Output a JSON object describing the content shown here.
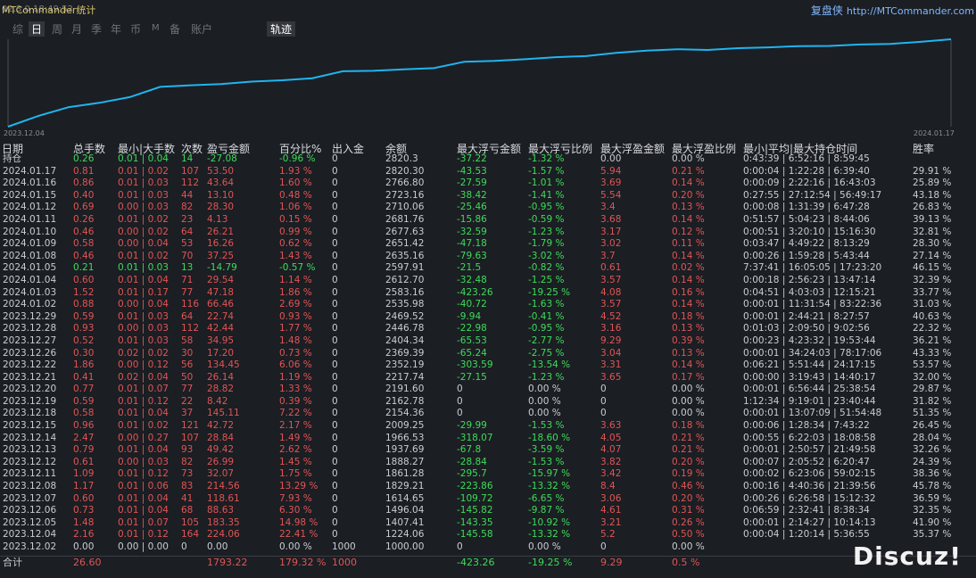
{
  "header": {
    "title": "MTCommander统计",
    "title_ghost": "02.3.0    18:49:52",
    "brand_name": "复盘侠",
    "brand_url": "http://MTCommander.com"
  },
  "tabs": [
    {
      "label": "综",
      "active": false
    },
    {
      "label": "日",
      "active": true
    },
    {
      "label": "周",
      "active": false
    },
    {
      "label": "月",
      "active": false
    },
    {
      "label": "季",
      "active": false
    },
    {
      "label": "年",
      "active": false
    },
    {
      "label": "币",
      "active": false
    },
    {
      "label": "M",
      "active": false
    },
    {
      "label": "备",
      "active": false
    },
    {
      "label": "账户",
      "active": false
    }
  ],
  "track_tab": "轨迹",
  "chart_data": {
    "type": "line",
    "x_start": "2023.12.04",
    "x_end": "2024.01.17",
    "x": [
      "2023.12.02",
      "2023.12.04",
      "2023.12.05",
      "2023.12.06",
      "2023.12.07",
      "2023.12.08",
      "2023.12.11",
      "2023.12.12",
      "2023.12.13",
      "2023.12.14",
      "2023.12.15",
      "2023.12.18",
      "2023.12.19",
      "2023.12.20",
      "2023.12.21",
      "2023.12.22",
      "2023.12.26",
      "2023.12.27",
      "2023.12.28",
      "2023.12.29",
      "2024.01.02",
      "2024.01.03",
      "2024.01.04",
      "2024.01.05",
      "2024.01.08",
      "2024.01.09",
      "2024.01.10",
      "2024.01.11",
      "2024.01.12",
      "2024.01.15",
      "2024.01.16",
      "2024.01.17"
    ],
    "values": [
      1000.0,
      1224.06,
      1407.41,
      1496.04,
      1614.65,
      1829.21,
      1861.28,
      1888.27,
      1937.69,
      1966.53,
      2009.25,
      2154.36,
      2162.78,
      2191.6,
      2217.74,
      2352.19,
      2369.39,
      2404.34,
      2446.78,
      2469.52,
      2535.98,
      2583.16,
      2612.7,
      2597.91,
      2635.16,
      2651.42,
      2677.63,
      2681.76,
      2710.06,
      2723.16,
      2766.8,
      2820.3
    ],
    "color": "#1fb5f0"
  },
  "table": {
    "columns": [
      "日期",
      "总手数",
      "最小|大手数",
      "次数",
      "盈亏金额",
      "百分比%",
      "出入金",
      "余额",
      "最大浮亏金额",
      "最大浮亏比例",
      "最大浮盈金额",
      "最大浮盈比例",
      "最小|平均|最大持仓时间",
      "胜率"
    ],
    "open_row": {
      "date": "持仓",
      "lots": "0.26",
      "minmax": "0.01 | 0.04",
      "count": "14",
      "pl": "-27.08",
      "pct": "-0.96 %",
      "io": "0",
      "balance": "2820.3",
      "maxloss": "-37.22",
      "maxloss_pct": "-1.32 %",
      "maxgain": "0.00",
      "maxgain_pct": "0.00 %",
      "hold": "0:43:39 | 6:52:16 | 8:59:45",
      "win": ""
    },
    "rows": [
      {
        "date": "2024.01.17",
        "lots": "0.81",
        "minmax": "0.01 | 0.02",
        "count": "107",
        "pl": "53.50",
        "pct": "1.93 %",
        "io": "0",
        "balance": "2820.30",
        "maxloss": "-43.53",
        "maxloss_pct": "-1.57 %",
        "maxgain": "5.94",
        "maxgain_pct": "0.21 %",
        "hold": "0:00:04 | 1:22:28 | 6:39:40",
        "win": "29.91 %"
      },
      {
        "date": "2024.01.16",
        "lots": "0.86",
        "minmax": "0.01 | 0.03",
        "count": "112",
        "pl": "43.64",
        "pct": "1.60 %",
        "io": "0",
        "balance": "2766.80",
        "maxloss": "-27.59",
        "maxloss_pct": "-1.01 %",
        "maxgain": "3.69",
        "maxgain_pct": "0.14 %",
        "hold": "0:00:09 | 2:22:16 | 16:43:03",
        "win": "25.89 %"
      },
      {
        "date": "2024.01.15",
        "lots": "0.40",
        "minmax": "0.01 | 0.03",
        "count": "44",
        "pl": "13.10",
        "pct": "0.48 %",
        "io": "0",
        "balance": "2723.16",
        "maxloss": "-38.42",
        "maxloss_pct": "-1.41 %",
        "maxgain": "5.54",
        "maxgain_pct": "0.20 %",
        "hold": "0:27:55 | 27:12:54 | 56:49:17",
        "win": "43.18 %"
      },
      {
        "date": "2024.01.12",
        "lots": "0.69",
        "minmax": "0.00 | 0.03",
        "count": "82",
        "pl": "28.30",
        "pct": "1.06 %",
        "io": "0",
        "balance": "2710.06",
        "maxloss": "-25.46",
        "maxloss_pct": "-0.95 %",
        "maxgain": "3.4",
        "maxgain_pct": "0.13 %",
        "hold": "0:00:08 | 1:31:39 | 6:47:28",
        "win": "26.83 %"
      },
      {
        "date": "2024.01.11",
        "lots": "0.26",
        "minmax": "0.01 | 0.02",
        "count": "23",
        "pl": "4.13",
        "pct": "0.15 %",
        "io": "0",
        "balance": "2681.76",
        "maxloss": "-15.86",
        "maxloss_pct": "-0.59 %",
        "maxgain": "3.68",
        "maxgain_pct": "0.14 %",
        "hold": "0:51:57 | 5:04:23 | 8:44:06",
        "win": "39.13 %"
      },
      {
        "date": "2024.01.10",
        "lots": "0.46",
        "minmax": "0.00 | 0.02",
        "count": "64",
        "pl": "26.21",
        "pct": "0.99 %",
        "io": "0",
        "balance": "2677.63",
        "maxloss": "-32.59",
        "maxloss_pct": "-1.23 %",
        "maxgain": "3.17",
        "maxgain_pct": "0.12 %",
        "hold": "0:00:51 | 3:20:10 | 15:16:30",
        "win": "32.81 %"
      },
      {
        "date": "2024.01.09",
        "lots": "0.58",
        "minmax": "0.00 | 0.04",
        "count": "53",
        "pl": "16.26",
        "pct": "0.62 %",
        "io": "0",
        "balance": "2651.42",
        "maxloss": "-47.18",
        "maxloss_pct": "-1.79 %",
        "maxgain": "3.02",
        "maxgain_pct": "0.11 %",
        "hold": "0:03:47 | 4:49:22 | 8:13:29",
        "win": "28.30 %"
      },
      {
        "date": "2024.01.08",
        "lots": "0.46",
        "minmax": "0.01 | 0.02",
        "count": "70",
        "pl": "37.25",
        "pct": "1.43 %",
        "io": "0",
        "balance": "2635.16",
        "maxloss": "-79.63",
        "maxloss_pct": "-3.02 %",
        "maxgain": "3.7",
        "maxgain_pct": "0.14 %",
        "hold": "0:00:26 | 1:59:28 | 5:43:44",
        "win": "27.14 %"
      },
      {
        "date": "2024.01.05",
        "lots": "0.21",
        "minmax": "0.01 | 0.03",
        "count": "13",
        "pl": "-14.79",
        "pct": "-0.57 %",
        "io": "0",
        "balance": "2597.91",
        "maxloss": "-21.5",
        "maxloss_pct": "-0.82 %",
        "maxgain": "0.61",
        "maxgain_pct": "0.02 %",
        "hold": "7:37:41 | 16:05:05 | 17:23:20",
        "win": "46.15 %",
        "positive": true
      },
      {
        "date": "2024.01.04",
        "lots": "0.60",
        "minmax": "0.01 | 0.04",
        "count": "71",
        "pl": "29.54",
        "pct": "1.14 %",
        "io": "0",
        "balance": "2612.70",
        "maxloss": "-32.48",
        "maxloss_pct": "-1.25 %",
        "maxgain": "3.57",
        "maxgain_pct": "0.14 %",
        "hold": "0:00:18 | 2:56:23 | 13:47:14",
        "win": "32.39 %"
      },
      {
        "date": "2024.01.03",
        "lots": "1.52",
        "minmax": "0.01 | 0.17",
        "count": "77",
        "pl": "47.18",
        "pct": "1.86 %",
        "io": "0",
        "balance": "2583.16",
        "maxloss": "-423.26",
        "maxloss_pct": "-19.25 %",
        "maxgain": "4.08",
        "maxgain_pct": "0.16 %",
        "hold": "0:04:51 | 4:03:03 | 12:15:21",
        "win": "33.77 %"
      },
      {
        "date": "2024.01.02",
        "lots": "0.88",
        "minmax": "0.00 | 0.04",
        "count": "116",
        "pl": "66.46",
        "pct": "2.69 %",
        "io": "0",
        "balance": "2535.98",
        "maxloss": "-40.72",
        "maxloss_pct": "-1.63 %",
        "maxgain": "3.57",
        "maxgain_pct": "0.14 %",
        "hold": "0:00:01 | 11:31:54 | 83:22:36",
        "win": "31.03 %"
      },
      {
        "date": "2023.12.29",
        "lots": "0.59",
        "minmax": "0.01 | 0.03",
        "count": "64",
        "pl": "22.74",
        "pct": "0.93 %",
        "io": "0",
        "balance": "2469.52",
        "maxloss": "-9.94",
        "maxloss_pct": "-0.41 %",
        "maxgain": "4.52",
        "maxgain_pct": "0.18 %",
        "hold": "0:00:01 | 2:44:21 | 8:27:57",
        "win": "40.63 %"
      },
      {
        "date": "2023.12.28",
        "lots": "0.93",
        "minmax": "0.00 | 0.03",
        "count": "112",
        "pl": "42.44",
        "pct": "1.77 %",
        "io": "0",
        "balance": "2446.78",
        "maxloss": "-22.98",
        "maxloss_pct": "-0.95 %",
        "maxgain": "3.16",
        "maxgain_pct": "0.13 %",
        "hold": "0:01:03 | 2:09:50 | 9:02:56",
        "win": "22.32 %"
      },
      {
        "date": "2023.12.27",
        "lots": "0.52",
        "minmax": "0.01 | 0.03",
        "count": "58",
        "pl": "34.95",
        "pct": "1.48 %",
        "io": "0",
        "balance": "2404.34",
        "maxloss": "-65.53",
        "maxloss_pct": "-2.77 %",
        "maxgain": "9.29",
        "maxgain_pct": "0.39 %",
        "hold": "0:00:23 | 4:23:32 | 19:53:44",
        "win": "36.21 %"
      },
      {
        "date": "2023.12.26",
        "lots": "0.30",
        "minmax": "0.02 | 0.02",
        "count": "30",
        "pl": "17.20",
        "pct": "0.73 %",
        "io": "0",
        "balance": "2369.39",
        "maxloss": "-65.24",
        "maxloss_pct": "-2.75 %",
        "maxgain": "3.04",
        "maxgain_pct": "0.13 %",
        "hold": "0:00:01 | 34:24:03 | 78:17:06",
        "win": "43.33 %"
      },
      {
        "date": "2023.12.22",
        "lots": "1.86",
        "minmax": "0.00 | 0.12",
        "count": "56",
        "pl": "134.45",
        "pct": "6.06 %",
        "io": "0",
        "balance": "2352.19",
        "maxloss": "-303.59",
        "maxloss_pct": "-13.54 %",
        "maxgain": "3.31",
        "maxgain_pct": "0.14 %",
        "hold": "0:06:21 | 5:51:44 | 24:17:15",
        "win": "53.57 %"
      },
      {
        "date": "2023.12.21",
        "lots": "0.41",
        "minmax": "0.02 | 0.04",
        "count": "50",
        "pl": "26.14",
        "pct": "1.19 %",
        "io": "0",
        "balance": "2217.74",
        "maxloss": "-27.15",
        "maxloss_pct": "-1.23 %",
        "maxgain": "3.65",
        "maxgain_pct": "0.17 %",
        "hold": "0:00:00 | 3:19:43 | 14:40:17",
        "win": "32.00 %"
      },
      {
        "date": "2023.12.20",
        "lots": "0.77",
        "minmax": "0.01 | 0.07",
        "count": "77",
        "pl": "28.82",
        "pct": "1.33 %",
        "io": "0",
        "balance": "2191.60",
        "maxloss": "0",
        "maxloss_pct": "0.00 %",
        "maxgain": "0",
        "maxgain_pct": "0.00 %",
        "hold": "0:00:01 | 6:56:44 | 25:38:54",
        "win": "29.87 %"
      },
      {
        "date": "2023.12.19",
        "lots": "0.59",
        "minmax": "0.01 | 0.12",
        "count": "22",
        "pl": "8.42",
        "pct": "0.39 %",
        "io": "0",
        "balance": "2162.78",
        "maxloss": "0",
        "maxloss_pct": "0.00 %",
        "maxgain": "0",
        "maxgain_pct": "0.00 %",
        "hold": "1:12:34 | 9:19:01 | 23:40:44",
        "win": "31.82 %"
      },
      {
        "date": "2023.12.18",
        "lots": "0.58",
        "minmax": "0.01 | 0.04",
        "count": "37",
        "pl": "145.11",
        "pct": "7.22 %",
        "io": "0",
        "balance": "2154.36",
        "maxloss": "0",
        "maxloss_pct": "0.00 %",
        "maxgain": "0",
        "maxgain_pct": "0.00 %",
        "hold": "0:00:01 | 13:07:09 | 51:54:48",
        "win": "51.35 %"
      },
      {
        "date": "2023.12.15",
        "lots": "0.96",
        "minmax": "0.01 | 0.02",
        "count": "121",
        "pl": "42.72",
        "pct": "2.17 %",
        "io": "0",
        "balance": "2009.25",
        "maxloss": "-29.99",
        "maxloss_pct": "-1.53 %",
        "maxgain": "3.63",
        "maxgain_pct": "0.18 %",
        "hold": "0:00:06 | 1:28:34 | 7:43:22",
        "win": "26.45 %"
      },
      {
        "date": "2023.12.14",
        "lots": "2.47",
        "minmax": "0.00 | 0.27",
        "count": "107",
        "pl": "28.84",
        "pct": "1.49 %",
        "io": "0",
        "balance": "1966.53",
        "maxloss": "-318.07",
        "maxloss_pct": "-18.60 %",
        "maxgain": "4.05",
        "maxgain_pct": "0.21 %",
        "hold": "0:00:55 | 6:22:03 | 18:08:58",
        "win": "28.04 %"
      },
      {
        "date": "2023.12.13",
        "lots": "0.79",
        "minmax": "0.01 | 0.04",
        "count": "93",
        "pl": "49.42",
        "pct": "2.62 %",
        "io": "0",
        "balance": "1937.69",
        "maxloss": "-67.8",
        "maxloss_pct": "-3.59 %",
        "maxgain": "4.07",
        "maxgain_pct": "0.21 %",
        "hold": "0:00:01 | 2:50:57 | 21:49:58",
        "win": "32.26 %"
      },
      {
        "date": "2023.12.12",
        "lots": "0.61",
        "minmax": "0.00 | 0.03",
        "count": "82",
        "pl": "26.99",
        "pct": "1.45 %",
        "io": "0",
        "balance": "1888.27",
        "maxloss": "-28.84",
        "maxloss_pct": "-1.53 %",
        "maxgain": "3.82",
        "maxgain_pct": "0.20 %",
        "hold": "0:00:07 | 2:05:52 | 6:20:47",
        "win": "24.39 %"
      },
      {
        "date": "2023.12.11",
        "lots": "1.09",
        "minmax": "0.01 | 0.12",
        "count": "73",
        "pl": "32.07",
        "pct": "1.75 %",
        "io": "0",
        "balance": "1861.28",
        "maxloss": "-295.7",
        "maxloss_pct": "-15.97 %",
        "maxgain": "3.42",
        "maxgain_pct": "0.19 %",
        "hold": "0:00:02 | 6:23:06 | 59:02:15",
        "win": "38.36 %"
      },
      {
        "date": "2023.12.08",
        "lots": "1.17",
        "minmax": "0.01 | 0.06",
        "count": "83",
        "pl": "214.56",
        "pct": "13.29 %",
        "io": "0",
        "balance": "1829.21",
        "maxloss": "-223.86",
        "maxloss_pct": "-13.32 %",
        "maxgain": "8.4",
        "maxgain_pct": "0.46 %",
        "hold": "0:00:16 | 4:40:36 | 21:39:56",
        "win": "45.78 %"
      },
      {
        "date": "2023.12.07",
        "lots": "0.60",
        "minmax": "0.01 | 0.04",
        "count": "41",
        "pl": "118.61",
        "pct": "7.93 %",
        "io": "0",
        "balance": "1614.65",
        "maxloss": "-109.72",
        "maxloss_pct": "-6.65 %",
        "maxgain": "3.06",
        "maxgain_pct": "0.20 %",
        "hold": "0:00:26 | 6:26:58 | 15:12:32",
        "win": "36.59 %"
      },
      {
        "date": "2023.12.06",
        "lots": "0.73",
        "minmax": "0.01 | 0.04",
        "count": "68",
        "pl": "88.63",
        "pct": "6.30 %",
        "io": "0",
        "balance": "1496.04",
        "maxloss": "-145.82",
        "maxloss_pct": "-9.87 %",
        "maxgain": "4.61",
        "maxgain_pct": "0.31 %",
        "hold": "0:06:59 | 2:32:41 | 8:38:34",
        "win": "32.35 %"
      },
      {
        "date": "2023.12.05",
        "lots": "1.48",
        "minmax": "0.01 | 0.07",
        "count": "105",
        "pl": "183.35",
        "pct": "14.98 %",
        "io": "0",
        "balance": "1407.41",
        "maxloss": "-143.35",
        "maxloss_pct": "-10.92 %",
        "maxgain": "3.21",
        "maxgain_pct": "0.26 %",
        "hold": "0:00:01 | 2:14:27 | 10:14:13",
        "win": "41.90 %"
      },
      {
        "date": "2023.12.04",
        "lots": "2.16",
        "minmax": "0.01 | 0.12",
        "count": "164",
        "pl": "224.06",
        "pct": "22.41 %",
        "io": "0",
        "balance": "1224.06",
        "maxloss": "-145.58",
        "maxloss_pct": "-13.32 %",
        "maxgain": "5.2",
        "maxgain_pct": "0.50 %",
        "hold": "0:00:04 | 1:20:14 | 5:36:55",
        "win": "35.37 %"
      },
      {
        "date": "2023.12.02",
        "lots": "0.00",
        "minmax": "0.00 | 0.00",
        "count": "0",
        "pl": "0.00",
        "pct": "0.00 %",
        "io": "1000",
        "balance": "1000.00",
        "maxloss": "0",
        "maxloss_pct": "0.00 %",
        "maxgain": "0",
        "maxgain_pct": "0.00 %",
        "hold": "",
        "win": "",
        "zero": true
      }
    ],
    "total": {
      "date": "合计",
      "lots": "26.60",
      "minmax": "",
      "count": "",
      "pl": "1793.22",
      "pct": "179.32 %",
      "io": "1000",
      "balance": "",
      "maxloss": "-423.26",
      "maxloss_pct": "-19.25 %",
      "maxgain": "9.29",
      "maxgain_pct": "0.5 %",
      "hold": "",
      "win": ""
    }
  },
  "watermark": "Discuz!"
}
